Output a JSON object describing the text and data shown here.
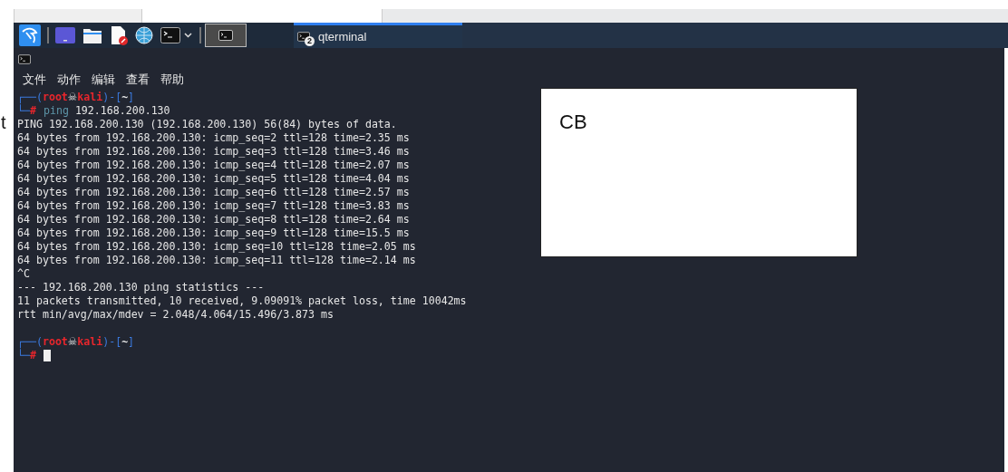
{
  "background": {
    "fragment": "t"
  },
  "taskbar": {
    "launchers": [
      {
        "kind": "kali"
      },
      {
        "kind": "desktop"
      },
      {
        "kind": "folder"
      },
      {
        "kind": "editor"
      },
      {
        "kind": "browser"
      },
      {
        "kind": "terminal"
      }
    ],
    "show_desktop": {
      "selected": true
    },
    "window_button": {
      "label": "qterminal",
      "badge": "2",
      "selected": true
    }
  },
  "terminal": {
    "menu": [
      "文件",
      "动作",
      "编辑",
      "查看",
      "帮助"
    ],
    "lines": [
      {
        "kind": "prompt",
        "open": "┌──(",
        "user": "root",
        "skull": "☠",
        "host": "kali",
        "sep": ")-[",
        "dir": "~",
        "close": "]",
        "corner": "└─",
        "symbol": "#",
        "program": "ping",
        "args": "192.168.200.130",
        "cursor": false
      },
      {
        "kind": "output",
        "text": "PING 192.168.200.130 (192.168.200.130) 56(84) bytes of data."
      },
      {
        "kind": "output",
        "text": "64 bytes from 192.168.200.130: icmp_seq=2 ttl=128 time=2.35 ms"
      },
      {
        "kind": "output",
        "text": "64 bytes from 192.168.200.130: icmp_seq=3 ttl=128 time=3.46 ms"
      },
      {
        "kind": "output",
        "text": "64 bytes from 192.168.200.130: icmp_seq=4 ttl=128 time=2.07 ms"
      },
      {
        "kind": "output",
        "text": "64 bytes from 192.168.200.130: icmp_seq=5 ttl=128 time=4.04 ms"
      },
      {
        "kind": "output",
        "text": "64 bytes from 192.168.200.130: icmp_seq=6 ttl=128 time=2.57 ms"
      },
      {
        "kind": "output",
        "text": "64 bytes from 192.168.200.130: icmp_seq=7 ttl=128 time=3.83 ms"
      },
      {
        "kind": "output",
        "text": "64 bytes from 192.168.200.130: icmp_seq=8 ttl=128 time=2.64 ms"
      },
      {
        "kind": "output",
        "text": "64 bytes from 192.168.200.130: icmp_seq=9 ttl=128 time=15.5 ms"
      },
      {
        "kind": "output",
        "text": "64 bytes from 192.168.200.130: icmp_seq=10 ttl=128 time=2.05 ms"
      },
      {
        "kind": "output",
        "text": "64 bytes from 192.168.200.130: icmp_seq=11 ttl=128 time=2.14 ms"
      },
      {
        "kind": "output",
        "text": "^C"
      },
      {
        "kind": "output",
        "text": "--- 192.168.200.130 ping statistics ---"
      },
      {
        "kind": "output",
        "text": "11 packets transmitted, 10 received, 9.09091% packet loss, time 10042ms"
      },
      {
        "kind": "output",
        "text": "rtt min/avg/max/mdev = 2.048/4.064/15.496/3.873 ms"
      },
      {
        "kind": "blank"
      },
      {
        "kind": "prompt",
        "open": "┌──(",
        "user": "root",
        "skull": "☠",
        "host": "kali",
        "sep": ")-[",
        "dir": "~",
        "close": "]",
        "corner": "└─",
        "symbol": "#",
        "cursor": true
      }
    ]
  },
  "overlay": {
    "text": "CB"
  }
}
